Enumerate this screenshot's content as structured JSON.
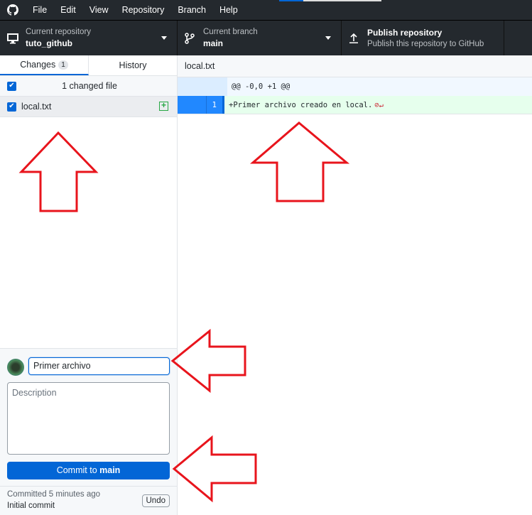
{
  "menu": {
    "items": [
      "File",
      "Edit",
      "View",
      "Repository",
      "Branch",
      "Help"
    ]
  },
  "toolbar": {
    "repo": {
      "label": "Current repository",
      "value": "tuto_github"
    },
    "branch": {
      "label": "Current branch",
      "value": "main"
    },
    "publish": {
      "title": "Publish repository",
      "subtitle": "Publish this repository to GitHub"
    }
  },
  "sidebar": {
    "tabs": [
      {
        "label": "Changes",
        "count": "1"
      },
      {
        "label": "History"
      }
    ],
    "changed_header": "1 changed file",
    "files": [
      {
        "name": "local.txt",
        "status": "added"
      }
    ]
  },
  "commit": {
    "summary": "Primer archivo",
    "description_placeholder": "Description",
    "button_prefix": "Commit to ",
    "button_branch": "main",
    "last_commit_time": "Committed 5 minutes ago",
    "last_commit_message": "Initial commit",
    "undo_label": "Undo"
  },
  "diff": {
    "filename": "local.txt",
    "hunk": "@@ -0,0 +1 @@",
    "lines": [
      {
        "number": "1",
        "text": "+Primer archivo creado en local.",
        "eol_marker": "⊘↵"
      }
    ]
  },
  "colors": {
    "accent": "#0366d6",
    "annotation": "#e8141c",
    "added_bg": "#e6ffed"
  }
}
